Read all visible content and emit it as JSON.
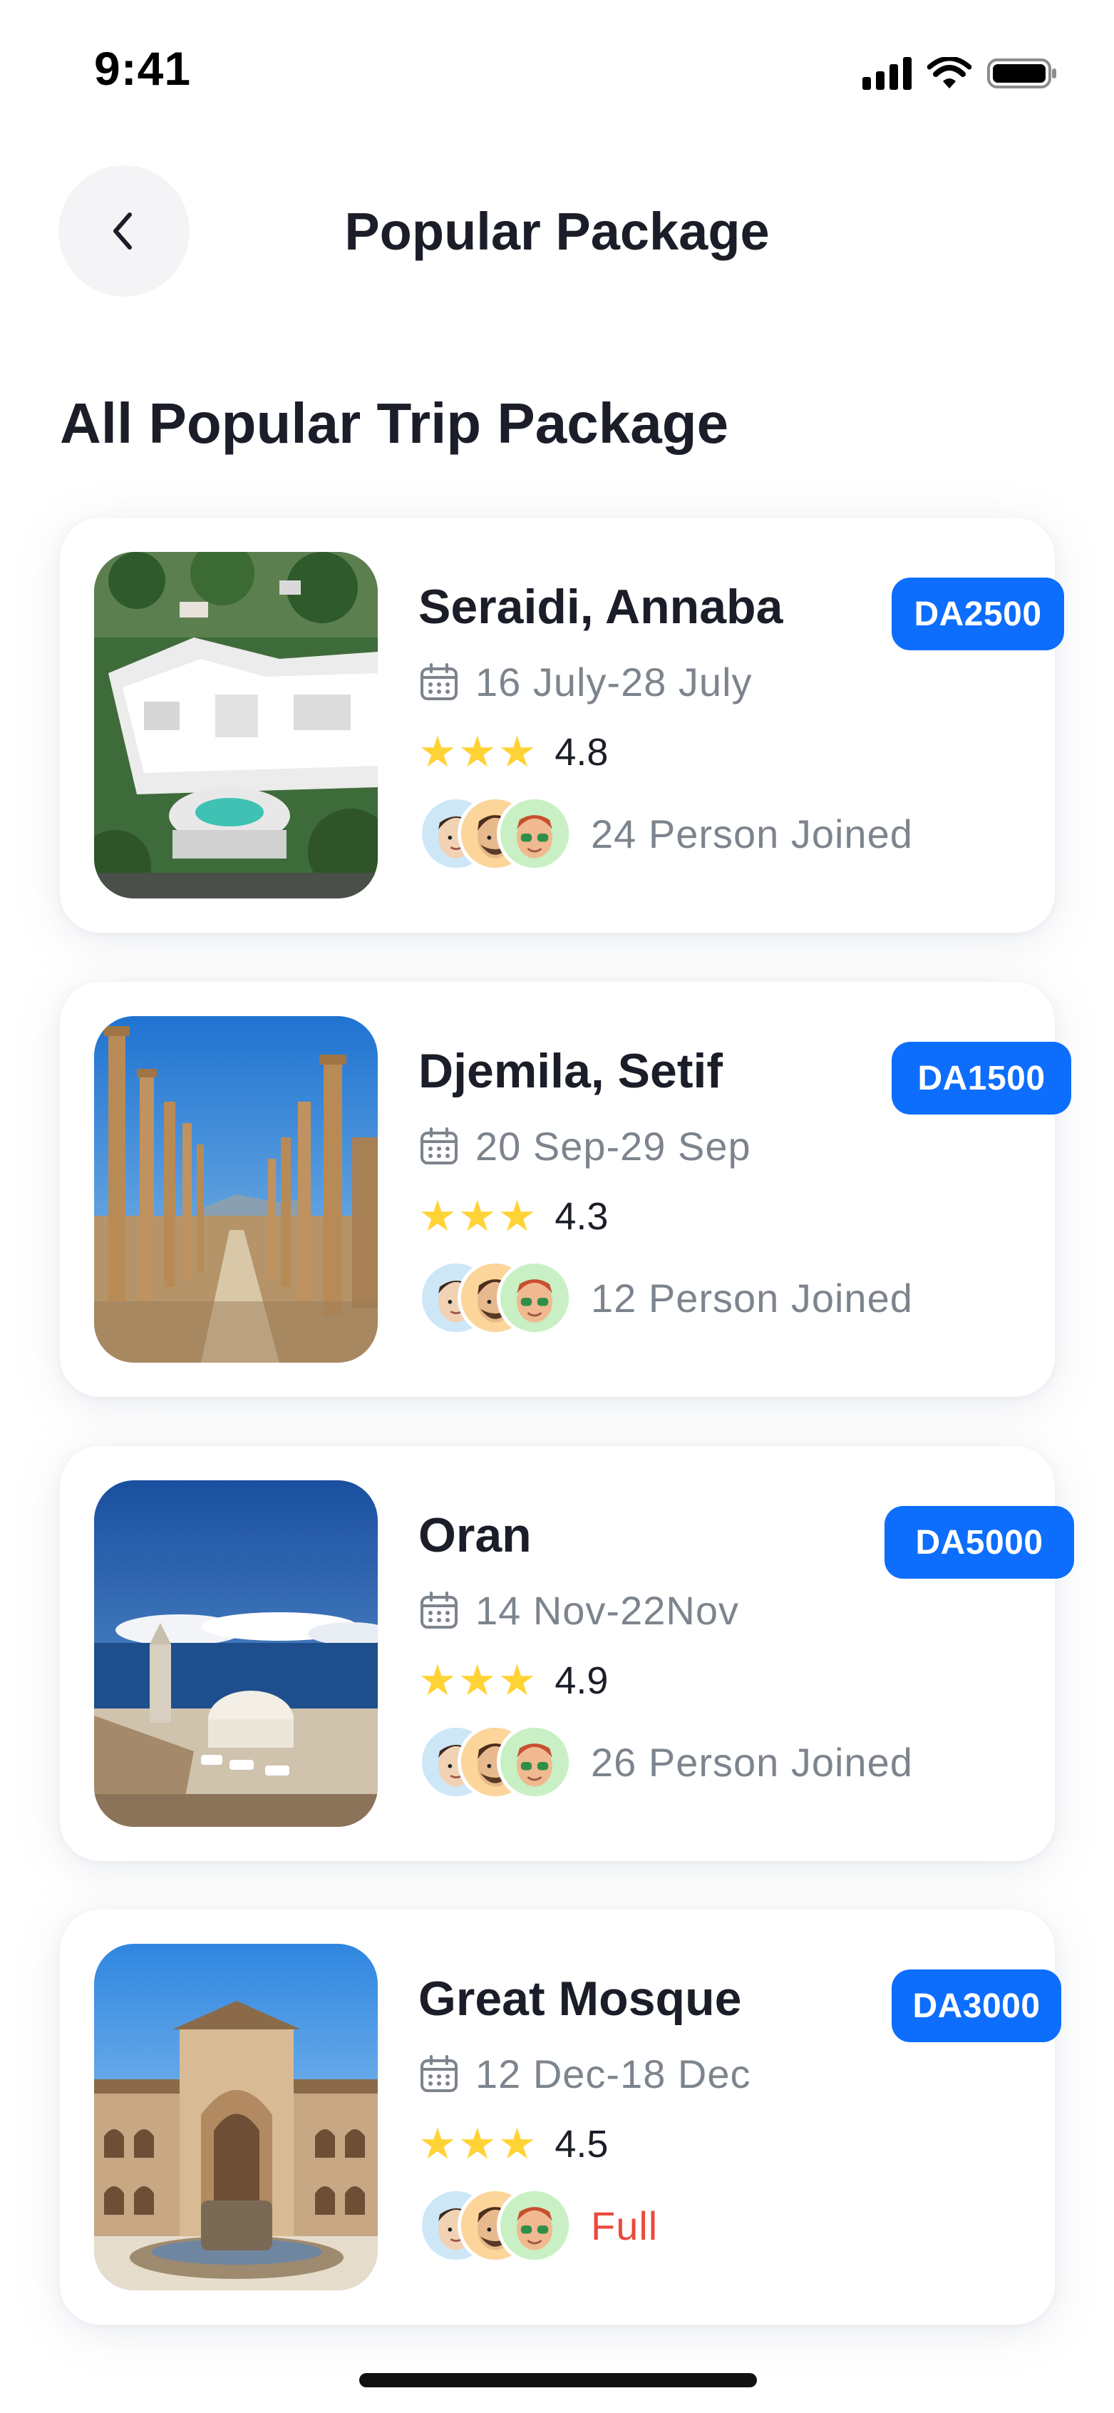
{
  "status_bar": {
    "time": "9:41"
  },
  "header": {
    "title": "Popular Package",
    "back_icon": "chevron-left-icon"
  },
  "section": {
    "title": "All Popular Trip Package"
  },
  "colors": {
    "accent": "#0D6EFD",
    "star": "#FFD336",
    "muted": "#7D848D",
    "full": "#EB4A3C"
  },
  "packages": [
    {
      "title": "Seraidi, Annaba",
      "price": "DA2500",
      "dates": "16 July-28 July",
      "rating": "4.8",
      "stars": 3,
      "joined": "24 Person Joined"
    },
    {
      "title": "Djemila, Setif",
      "price": "DA1500",
      "dates": "20 Sep-29 Sep",
      "rating": "4.3",
      "stars": 3,
      "joined": "12 Person Joined"
    },
    {
      "title": "Oran",
      "price": "DA5000",
      "dates": "14 Nov-22Nov",
      "rating": "4.9",
      "stars": 3,
      "joined": "26 Person Joined"
    },
    {
      "title": "Great Mosque",
      "price": "DA3000",
      "dates": "12 Dec-18 Dec",
      "rating": "4.5",
      "stars": 3,
      "joined": "Full"
    }
  ]
}
